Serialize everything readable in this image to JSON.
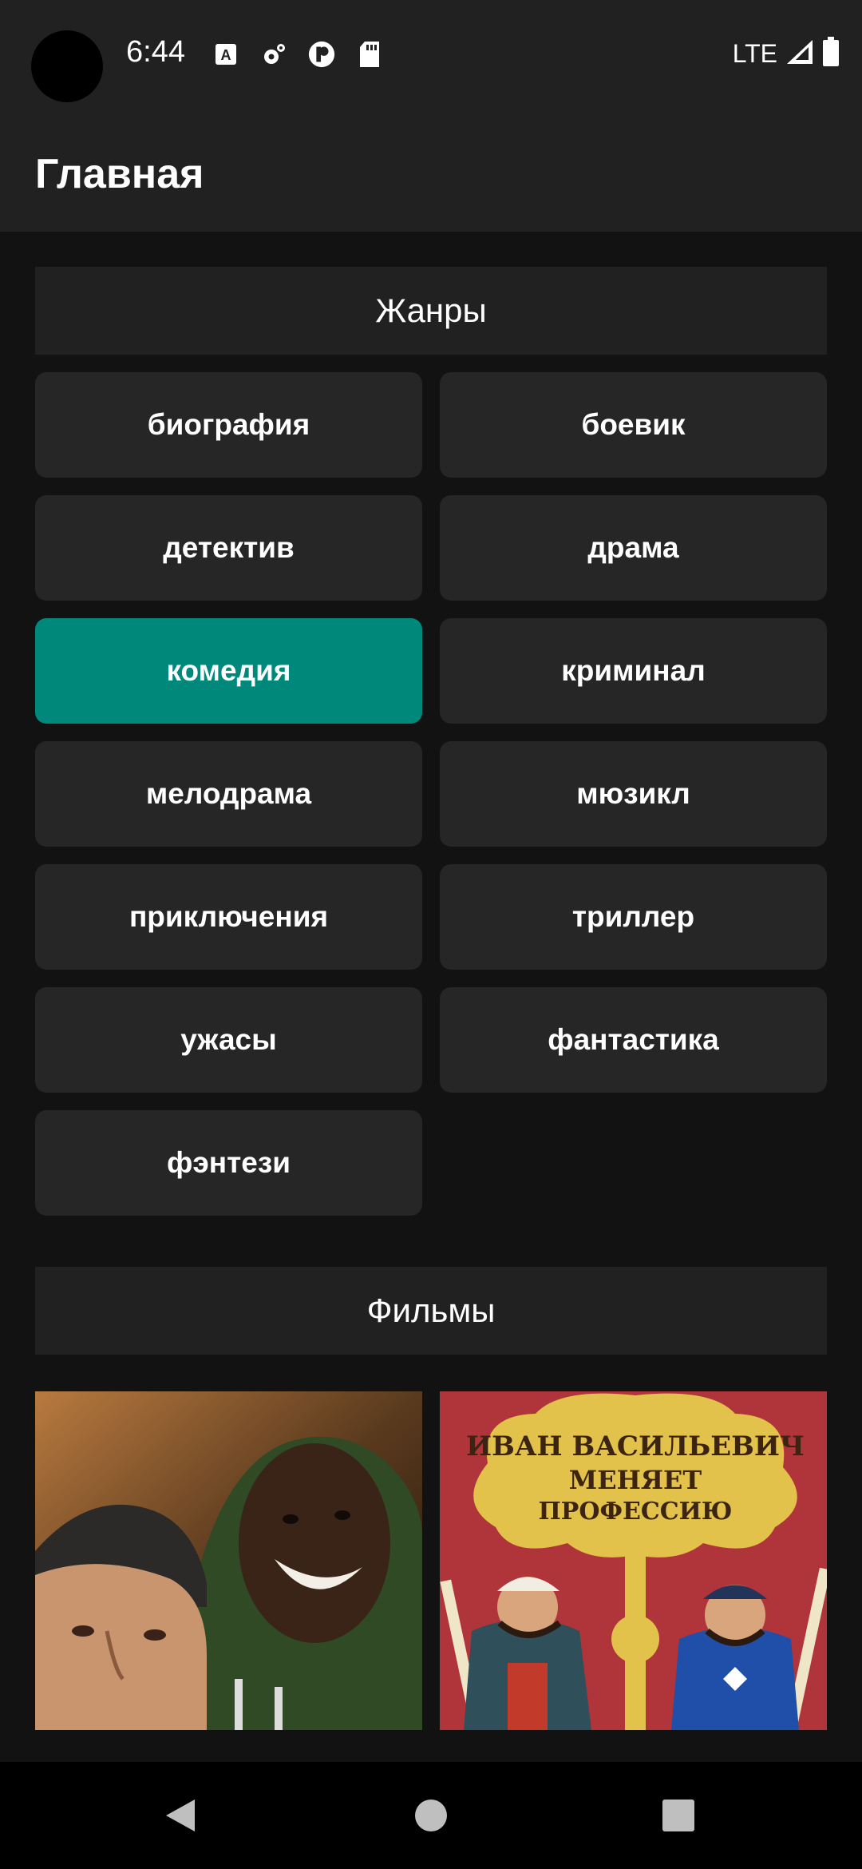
{
  "status_bar": {
    "time": "6:44",
    "network": "LTE",
    "icons": [
      "a-keyboard-icon",
      "gear-icon",
      "cast-icon",
      "sd-card-icon",
      "signal-icon",
      "battery-icon"
    ]
  },
  "app_bar": {
    "title": "Главная"
  },
  "genres": {
    "header": "Жанры",
    "items": [
      {
        "label": "биография"
      },
      {
        "label": "боевик"
      },
      {
        "label": "детектив"
      },
      {
        "label": "драма"
      },
      {
        "label": "комедия",
        "selected": true
      },
      {
        "label": "криминал"
      },
      {
        "label": "мелодрама"
      },
      {
        "label": "мюзикл"
      },
      {
        "label": "приключения"
      },
      {
        "label": "триллер"
      },
      {
        "label": "ужасы"
      },
      {
        "label": "фантастика"
      },
      {
        "label": "фэнтези"
      }
    ]
  },
  "films": {
    "header": "Фильмы",
    "posters": [
      {
        "image": "two-men-smiling-poster"
      },
      {
        "image": "ivan-vasilievich-poster",
        "poster_text": [
          "ИВАН ВАСИЛЬЕВИЧ",
          "МЕНЯЕТ",
          "ПРОФЕССИЮ"
        ]
      }
    ]
  },
  "colors": {
    "accent": "#00897b",
    "button": "#262626",
    "surface": "#212121",
    "background": "#121212"
  },
  "nav_bar": {
    "buttons": [
      "back-icon",
      "home-icon",
      "recents-icon"
    ]
  }
}
